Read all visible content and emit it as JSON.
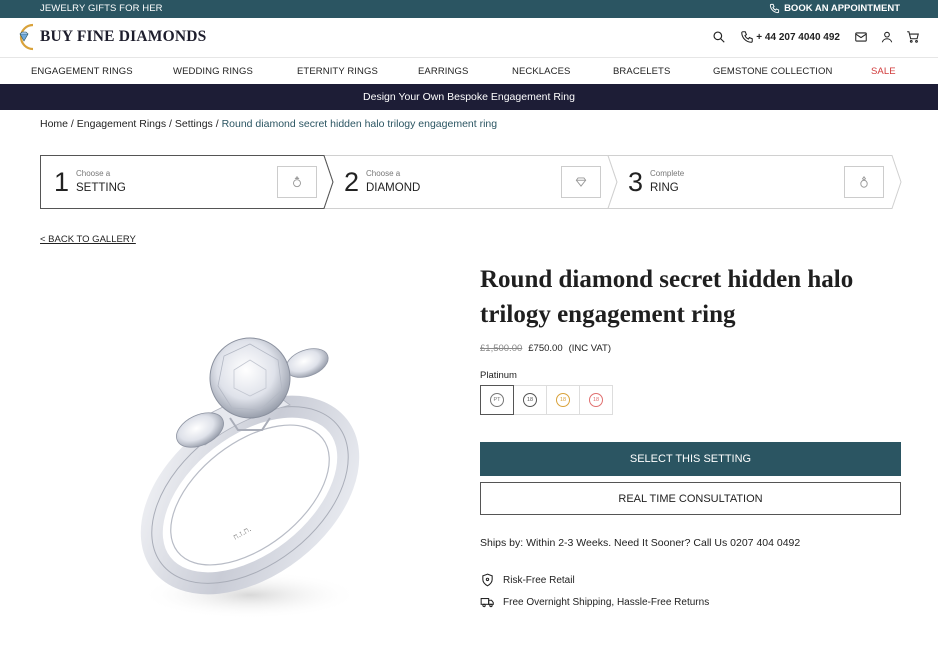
{
  "topbar": {
    "left_text": "JEWELRY GIFTS FOR HER",
    "appointment": "BOOK AN APPOINTMENT"
  },
  "header": {
    "logo_text": "BUY FINE DIAMONDS",
    "phone": "+ 44 207 4040 492"
  },
  "nav": {
    "items": [
      "ENGAGEMENT RINGS",
      "WEDDING RINGS",
      "ETERNITY RINGS",
      "EARRINGS",
      "NECKLACES",
      "BRACELETS",
      "GEMSTONE COLLECTION",
      "SALE"
    ]
  },
  "promo": {
    "text": "Design Your Own Bespoke Engagement Ring"
  },
  "breadcrumb": {
    "home": "Home",
    "engagement": "Engagement Rings",
    "settings": "Settings",
    "current": "Round diamond secret hidden halo trilogy engagement ring",
    "separator": " / "
  },
  "steps": [
    {
      "number": "1",
      "small": "Choose a",
      "label": "SETTING",
      "icon": "ring-icon"
    },
    {
      "number": "2",
      "small": "Choose a",
      "label": "DIAMOND",
      "icon": "diamond-icon"
    },
    {
      "number": "3",
      "small": "Complete",
      "label": "RING",
      "icon": "ring-icon"
    }
  ],
  "back_link": "< BACK TO GALLERY",
  "product": {
    "title": "Round diamond secret hidden halo trilogy engagement ring",
    "old_price": "£1,500.00",
    "price": "£750.00",
    "vat": "(INC VAT)",
    "metal_label": "Platinum",
    "metals": [
      {
        "code": "PT",
        "color": "#777777",
        "selected": true
      },
      {
        "code": "18",
        "color": "#555555",
        "selected": false
      },
      {
        "code": "18",
        "color": "#d9a23a",
        "selected": false
      },
      {
        "code": "18",
        "color": "#e06f6f",
        "selected": false
      }
    ],
    "select_button": "SELECT THIS SETTING",
    "consult_button": "REAL TIME CONSULTATION",
    "ships": "Ships by: Within 2-3 Weeks. Need It Sooner? Call Us 0207 404 0492",
    "features": [
      "Risk-Free Retail",
      "Free Overnight Shipping, Hassle-Free Returns"
    ]
  },
  "colors": {
    "brand_teal": "#2b5562",
    "promo_navy": "#1d1d36",
    "sale_red": "#d03b3b"
  }
}
